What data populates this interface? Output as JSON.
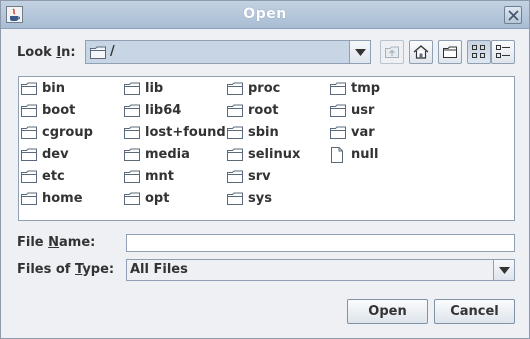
{
  "window": {
    "title": "Open"
  },
  "look_in": {
    "label": "Look In:",
    "label_pre": "Look ",
    "label_mnemonic": "I",
    "label_post": "n:",
    "value": "/"
  },
  "toolbar": {
    "up_folder_icon": "up-folder-icon",
    "home_icon": "home-icon",
    "new_folder_icon": "new-folder-icon",
    "list_view_icon": "list-view-icon",
    "details_view_icon": "details-view-icon"
  },
  "files": [
    {
      "name": "bin",
      "type": "folder"
    },
    {
      "name": "boot",
      "type": "folder"
    },
    {
      "name": "cgroup",
      "type": "folder"
    },
    {
      "name": "dev",
      "type": "folder"
    },
    {
      "name": "etc",
      "type": "folder"
    },
    {
      "name": "home",
      "type": "folder"
    },
    {
      "name": "lib",
      "type": "folder"
    },
    {
      "name": "lib64",
      "type": "folder"
    },
    {
      "name": "lost+found",
      "type": "folder"
    },
    {
      "name": "media",
      "type": "folder"
    },
    {
      "name": "mnt",
      "type": "folder"
    },
    {
      "name": "opt",
      "type": "folder"
    },
    {
      "name": "proc",
      "type": "folder"
    },
    {
      "name": "root",
      "type": "folder"
    },
    {
      "name": "sbin",
      "type": "folder"
    },
    {
      "name": "selinux",
      "type": "folder"
    },
    {
      "name": "srv",
      "type": "folder"
    },
    {
      "name": "sys",
      "type": "folder"
    },
    {
      "name": "tmp",
      "type": "folder"
    },
    {
      "name": "usr",
      "type": "folder"
    },
    {
      "name": "var",
      "type": "folder"
    },
    {
      "name": "null",
      "type": "file"
    }
  ],
  "file_name": {
    "label": "File Name:",
    "label_pre": "File ",
    "label_mnemonic": "N",
    "label_post": "ame:",
    "value": ""
  },
  "file_type": {
    "label": "Files of Type:",
    "label_pre": "Files of ",
    "label_mnemonic": "T",
    "label_post": "ype:",
    "value": "All Files"
  },
  "buttons": {
    "open": "Open",
    "cancel": "Cancel"
  },
  "colors": {
    "titlebar": "#b4c6da",
    "selection": "#c7d5e4",
    "folder": "#5a6a7c"
  }
}
